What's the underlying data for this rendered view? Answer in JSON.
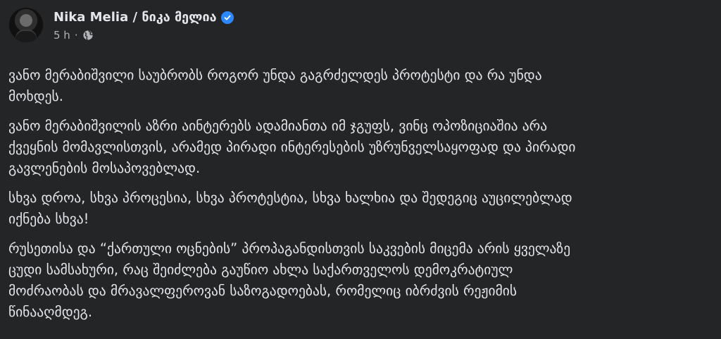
{
  "post": {
    "author": {
      "name": "Nika Melia / ნიკა მელია",
      "verified": true
    },
    "meta": {
      "time": "5 h",
      "separator": "·",
      "audience_icon": "globe-icon"
    },
    "paragraphs": [
      "ვანო მერაბიშვილი საუბრობს როგორ უნდა გაგრძელდეს პროტესტი და რა უნდა\nმოხდეს.",
      "ვანო მერაბიშვილის აზრი აინტერებს ადამიანთა იმ ჯგუფს, ვინც ოპოზიციაშია არა\nქვეყნის მომავლისთვის, არამედ პირადი ინტერესების უზრუნველსაყოფად და პირადი\nგავლენების მოსაპოვებლად.",
      "სხვა დროა, სხვა პროცესია, სხვა პროტესტია, სხვა ხალხია და შედეგიც აუცილებლად\nიქნება სხვა!",
      "რუსეთისა და “ქართული ოცნების” პროპაგანდისთვის საკვების მიცემა არის ყველაზე\nცუდი სამსახური, რაც შეიძლება გაუწიო ახლა საქართველოს დემოკრატიულ\nმოძრაობას და მრავალფეროვან საზოგადოებას, რომელიც იბრძვის რეჟიმის\nწინააღმდეგ."
    ],
    "colors": {
      "background": "#242526",
      "text": "#e4e6eb",
      "secondary_text": "#b0b3b8",
      "verified_badge": "#2d88ff"
    }
  }
}
